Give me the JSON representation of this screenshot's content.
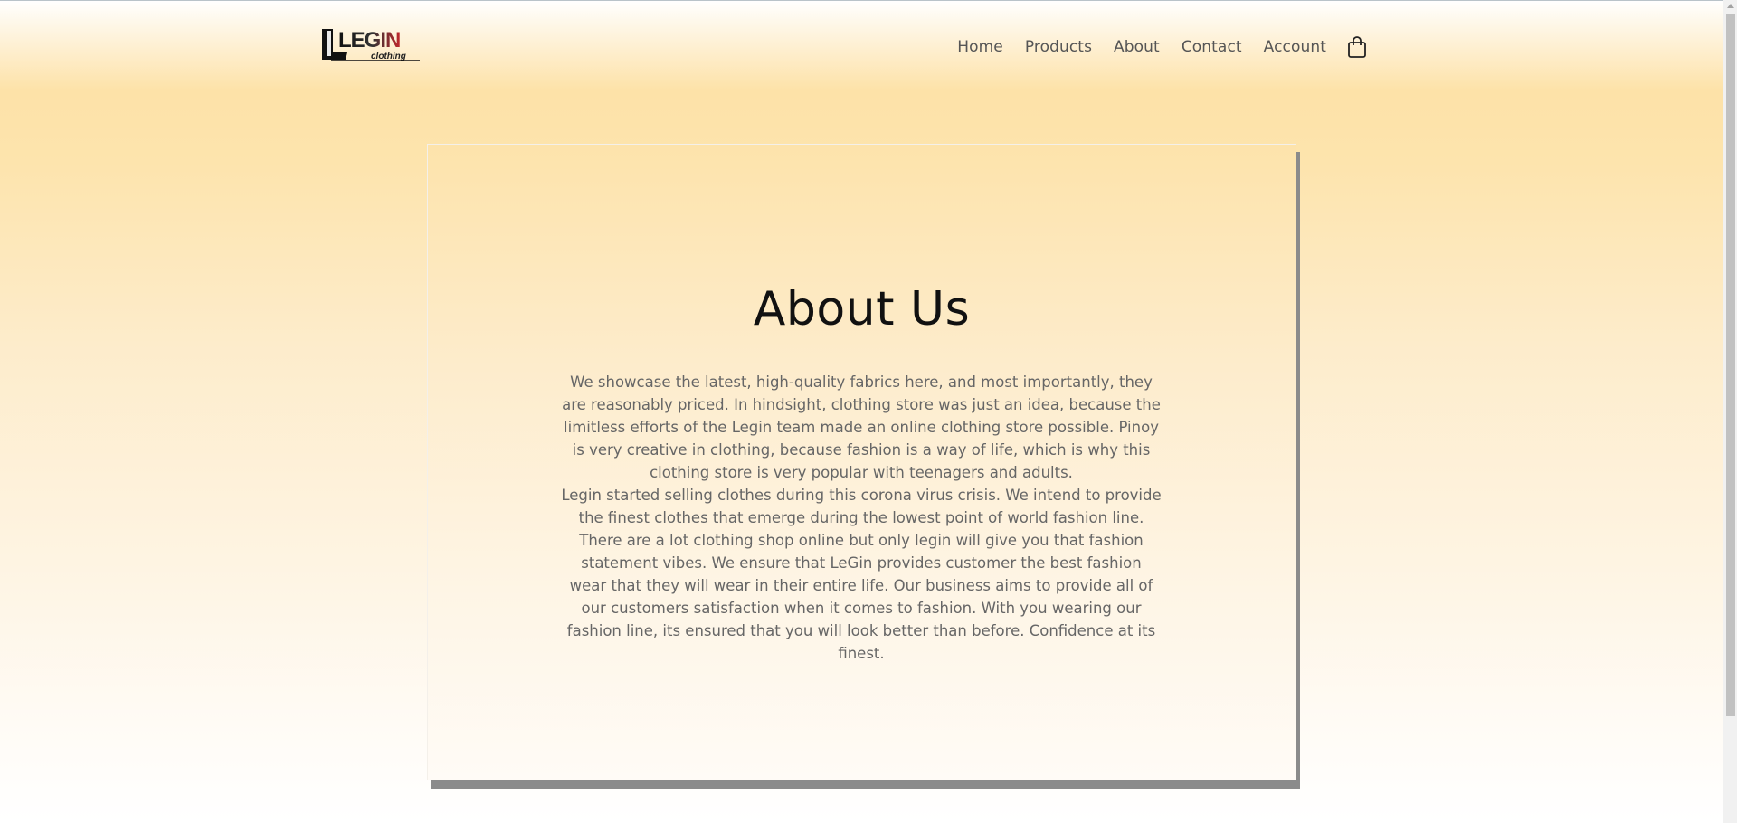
{
  "brand": {
    "logo_text": "LEGIN",
    "logo_subtext": "clothing",
    "logo_colors": {
      "dark": "#111111",
      "accent": "#c0282d"
    }
  },
  "nav": {
    "items": [
      {
        "label": "Home"
      },
      {
        "label": "Products"
      },
      {
        "label": "About"
      },
      {
        "label": "Contact"
      },
      {
        "label": "Account"
      }
    ],
    "cart_icon": "shopping-bag-icon"
  },
  "about": {
    "title": "About Us",
    "paragraphs": [
      "We showcase the latest, high-quality fabrics here, and most importantly, they are reasonably priced. In hindsight, clothing store was just an idea, because the limitless efforts of the Legin team made an online clothing store possible. Pinoy is very creative in clothing, because fashion is a way of life, which is why this clothing store is very popular with teenagers and adults.",
      "Legin started selling clothes during this corona virus crisis. We intend to provide the finest clothes that emerge during the lowest point of world fashion line. There are a lot clothing shop online but only legin will give you that fashion statement vibes. We ensure that LeGin provides customer the best fashion wear that they will wear in their entire life. Our business aims to provide all of our customers satisfaction when it comes to fashion. With you wearing our fashion line, its ensured that you will look better than before. Confidence at its finest."
    ]
  },
  "colors": {
    "background_top": "#fde2a8",
    "background_bottom": "#ffffff",
    "card_shadow": "#8b8b8b",
    "title_text": "#111111",
    "body_text": "#666666",
    "nav_text": "#555555"
  }
}
